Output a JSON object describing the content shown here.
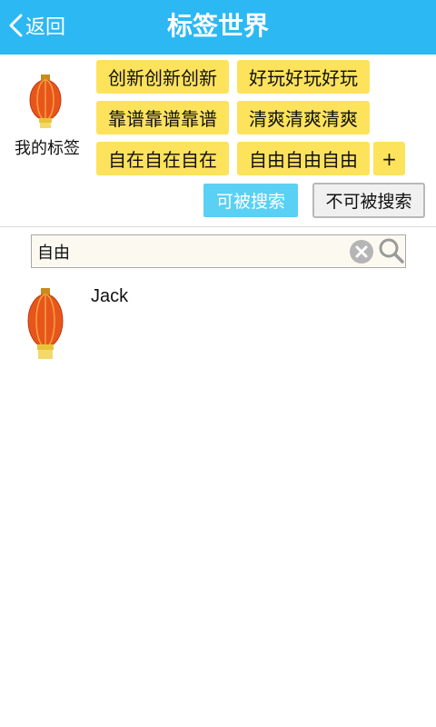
{
  "header": {
    "back_label": "返回",
    "title": "标签世界"
  },
  "my_tags": {
    "label": "我的标签",
    "avatar_icon": "lantern-icon",
    "tags": [
      "创新创新创新",
      "好玩好玩好玩",
      "靠谱靠谱靠谱",
      "清爽清爽清爽",
      "自在自在自在",
      "自由自由自由"
    ],
    "add_label": "+",
    "searchable_label": "可被搜索",
    "unsearchable_label": "不可被搜索"
  },
  "search": {
    "value": "自由"
  },
  "results": [
    {
      "name": "Jack",
      "avatar_icon": "lantern-icon"
    }
  ],
  "colors": {
    "header_bg": "#2cb8f3",
    "tag_bg": "#fde25c",
    "searchable_bg": "#5ad0f5"
  }
}
